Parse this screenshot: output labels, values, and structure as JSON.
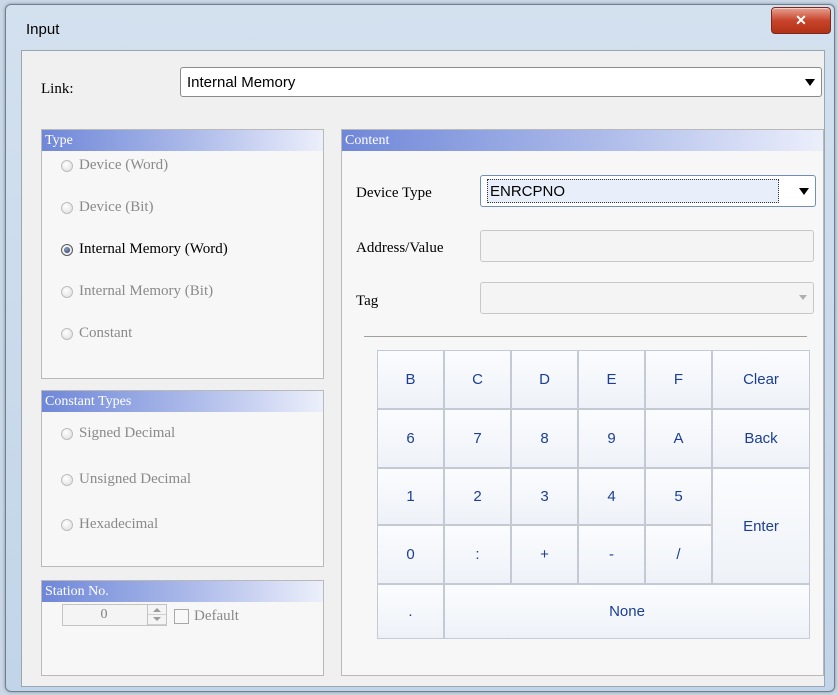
{
  "window": {
    "title": "Input",
    "close_glyph": "✕"
  },
  "link": {
    "label": "Link:",
    "value": "Internal Memory"
  },
  "type_group": {
    "header": "Type",
    "options": [
      {
        "label": "Device (Word)",
        "checked": false
      },
      {
        "label": "Device (Bit)",
        "checked": false
      },
      {
        "label": "Internal Memory (Word)",
        "checked": true
      },
      {
        "label": "Internal Memory (Bit)",
        "checked": false
      },
      {
        "label": "Constant",
        "checked": false
      }
    ]
  },
  "constant_group": {
    "header": "Constant Types",
    "options": [
      {
        "label": "Signed Decimal"
      },
      {
        "label": "Unsigned Decimal"
      },
      {
        "label": "Hexadecimal"
      }
    ]
  },
  "station_group": {
    "header": "Station No.",
    "value": "0",
    "default_label": "Default"
  },
  "content": {
    "header": "Content",
    "device_type_label": "Device Type",
    "device_type_value": "ENRCPNO",
    "address_label": "Address/Value",
    "address_value": "",
    "tag_label": "Tag",
    "tag_value": ""
  },
  "keypad": {
    "rows": [
      [
        "B",
        "C",
        "D",
        "E",
        "F",
        "Clear"
      ],
      [
        "6",
        "7",
        "8",
        "9",
        "A",
        "Back"
      ],
      [
        "1",
        "2",
        "3",
        "4",
        "5"
      ],
      [
        "0",
        ":",
        "+",
        "-",
        "/"
      ]
    ],
    "enter": "Enter",
    "dot": ".",
    "none": "None"
  },
  "colors": {
    "group_header_start": "#6f87d8",
    "key_text": "#1c3f94",
    "close_button": "#c8442c"
  }
}
